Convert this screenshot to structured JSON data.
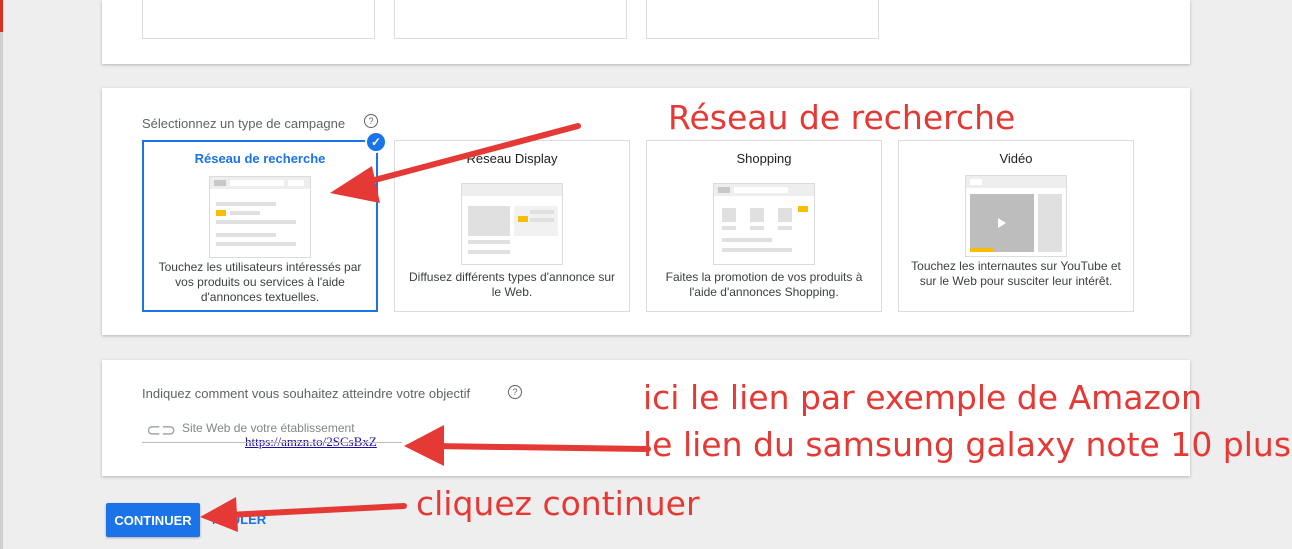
{
  "campaign_type": {
    "label": "Sélectionnez un type de campagne",
    "help_glyph": "?",
    "check_glyph": "✓",
    "cards": [
      {
        "title": "Réseau de recherche",
        "description": "Touchez les utilisateurs intéressés par vos produits ou services à l'aide d'annonces textuelles.",
        "selected": true
      },
      {
        "title": "Reseau Display",
        "description": "Diffusez différents types d'annonce sur le Web.",
        "selected": false
      },
      {
        "title": "Shopping",
        "description": "Faites la promotion de vos produits à l'aide d'annonces Shopping.",
        "selected": false
      },
      {
        "title": "Vidéo",
        "description": "Touchez les internautes sur YouTube et sur le Web pour susciter leur intérêt.",
        "selected": false
      }
    ]
  },
  "goal": {
    "label": "Indiquez comment vous souhaitez atteindre votre objectif",
    "help_glyph": "?",
    "link_icon": "link-icon",
    "link_glyph": "⊂⊃",
    "website_placeholder": "Site Web de votre établissement",
    "website_value": "https://amzn.to/2SCsBxZ"
  },
  "actions": {
    "continue_label": "CONTINUER",
    "cancel_label": "NNULER"
  },
  "annotations": {
    "search_network": "Réseau de recherche",
    "link_line1": "ici le lien par exemple de Amazon",
    "link_line2": "le lien du samsung galaxy note 10 plus",
    "click_continue": "cliquez continuer",
    "color": "#e53935"
  },
  "colors": {
    "accent": "#1a73e8",
    "annotation_red": "#e53935",
    "yellow": "#fbbc04"
  }
}
